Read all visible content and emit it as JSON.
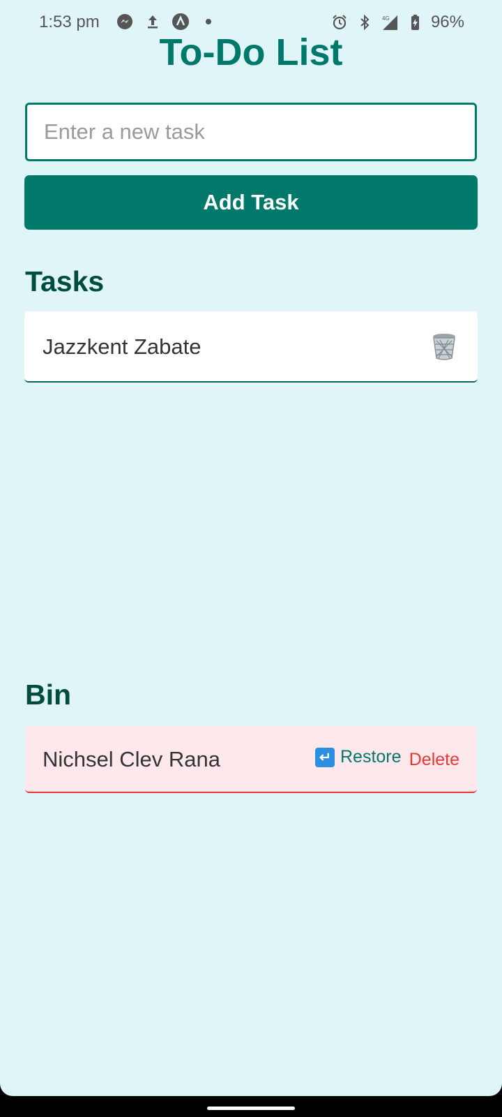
{
  "status_bar": {
    "time": "1:53 pm",
    "left_icons": [
      "messenger-icon",
      "upload-icon",
      "app-icon",
      "dot-icon"
    ],
    "right_icons": [
      "alarm-icon",
      "bluetooth-icon",
      "signal-4g-icon",
      "battery-charging-icon"
    ],
    "battery": "96%"
  },
  "app": {
    "title": "To-Do List",
    "input_placeholder": "Enter a new task",
    "input_value": "",
    "add_button_label": "Add Task",
    "accent_color": "#00796b"
  },
  "tasks": {
    "heading": "Tasks",
    "items": [
      {
        "text": "Jazzkent Zabate",
        "action_icon": "trash-icon"
      }
    ]
  },
  "bin": {
    "heading": "Bin",
    "items": [
      {
        "text": "Nichsel Clev Rana",
        "restore_label": "Restore",
        "delete_label": "Delete",
        "restore_icon": "restore-icon"
      }
    ]
  }
}
